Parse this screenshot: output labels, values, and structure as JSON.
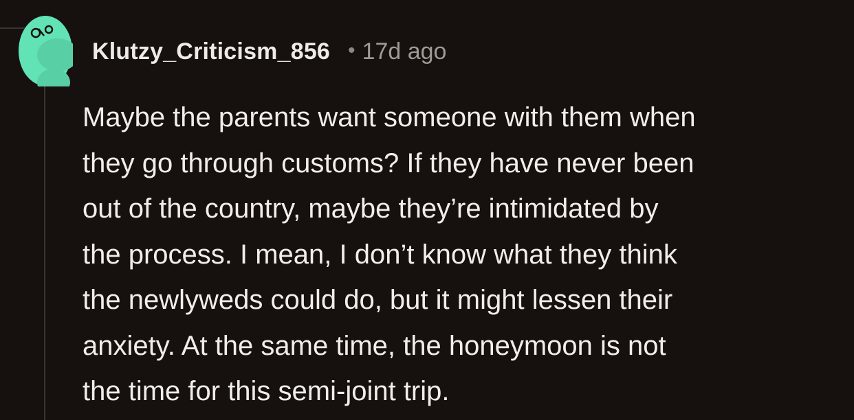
{
  "comment": {
    "username": "Klutzy_Criticism_856",
    "separator": "•",
    "timestamp": "17d ago",
    "avatar_icon": "snoo-avatar-icon",
    "avatar_color": "#62e3b6",
    "body_lines": [
      "Maybe the parents want someone with them when",
      "they go through customs? If they have never been",
      "out of the country, maybe they’re intimidated by",
      "the process. I mean, I don’t know what they think",
      "the newlyweds could do, but it might lessen their",
      "anxiety. At the same time, the honeymoon is not",
      "the time for this semi-joint trip."
    ]
  },
  "colors": {
    "background": "#16110f",
    "text": "#f1edea",
    "muted": "#a09a94",
    "thread_line": "#3a3532"
  }
}
